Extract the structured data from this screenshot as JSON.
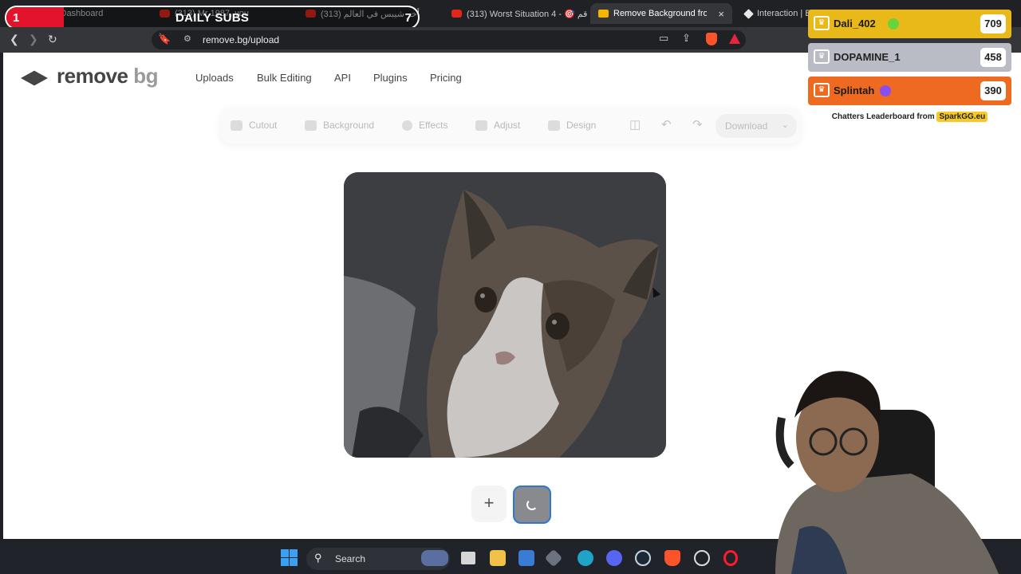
{
  "browser": {
    "tabs": [
      {
        "title": "ick Dashboard"
      },
      {
        "title": "(313) Mr 1987, you"
      },
      {
        "title": "أخر شيبس في العالم (313)"
      },
      {
        "title": "(313) Worst Situation 4 - 🎯 قم"
      },
      {
        "title": "Remove Background from I"
      },
      {
        "title": "Interaction | B"
      }
    ],
    "tab_close": "×",
    "url": "remove.bg/upload"
  },
  "stream": {
    "daily_subs": {
      "label": "DAILY SUBS",
      "count": "1",
      "goal": "7",
      "progress": 0.14
    },
    "leaderboard": {
      "entries": [
        {
          "name": "Dali_402",
          "score": "709",
          "color": "#e9b919",
          "badge_color": "#68d43a"
        },
        {
          "name": "DOPAMINE_1",
          "score": "458",
          "color": "#b9bcc4",
          "badge_color": ""
        },
        {
          "name": "Splintah",
          "score": "390",
          "color": "#ee6a21",
          "badge_color": "#8a4df0"
        }
      ],
      "footer": "Chatters Leaderboard from",
      "footer_brand": "SparkGG.eu"
    }
  },
  "site": {
    "logo": {
      "word1": "remove",
      "word2": "bg"
    },
    "nav": [
      "Uploads",
      "Bulk Editing",
      "API",
      "Plugins",
      "Pricing"
    ],
    "editbar": {
      "tools": [
        "Cutout",
        "Background",
        "Effects",
        "Adjust",
        "Design"
      ],
      "download": "Download"
    },
    "add_button": "+"
  },
  "taskbar": {
    "search": "Search"
  }
}
